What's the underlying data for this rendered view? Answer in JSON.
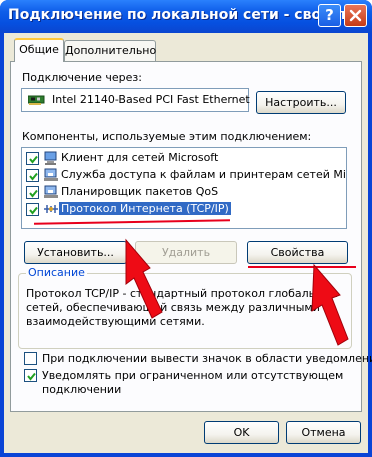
{
  "window": {
    "title": "Подключение по локальной сети - свойства",
    "help_glyph": "?"
  },
  "tabs": [
    {
      "label": "Общие",
      "active": true
    },
    {
      "label": "Дополнительно",
      "active": false
    }
  ],
  "connection": {
    "label": "Подключение через:",
    "adapter": "Intel 21140-Based PCI Fast Ethernet",
    "adapter_icon": "network-card-icon",
    "configure_label": "Настроить..."
  },
  "components": {
    "label": "Компоненты, используемые этим подключением:",
    "items": [
      {
        "label": "Клиент для сетей Microsoft",
        "checked": true,
        "icon": "client-icon",
        "selected": false
      },
      {
        "label": "Служба доступа к файлам и принтерам сетей Micro...",
        "checked": true,
        "icon": "service-icon",
        "selected": false
      },
      {
        "label": "Планировщик пакетов QoS",
        "checked": true,
        "icon": "service-icon",
        "selected": false
      },
      {
        "label": "Протокол Интернета (TCP/IP)",
        "checked": true,
        "icon": "protocol-icon",
        "selected": true
      }
    ]
  },
  "buttons": {
    "install": "Установить...",
    "remove": "Удалить",
    "properties": "Свойства",
    "ok": "OK",
    "cancel": "Отмена"
  },
  "description": {
    "title": "Описание",
    "lines": [
      "Протокол TCP/IP - стандартный протокол глобальных",
      "сетей, обеспечивающий связь между различными",
      "взаимодействующими сетями."
    ]
  },
  "options": [
    {
      "lines": [
        "При подключении вывести значок в области уведомлений"
      ],
      "checked": false
    },
    {
      "lines": [
        "Уведомлять при ограниченном или отсутствующем",
        "подключении"
      ],
      "checked": true
    }
  ],
  "colors": {
    "title_bar": "#0a54e3",
    "selection": "#316ac5",
    "annotation": "#e8001c",
    "group_title": "#0046d5"
  }
}
